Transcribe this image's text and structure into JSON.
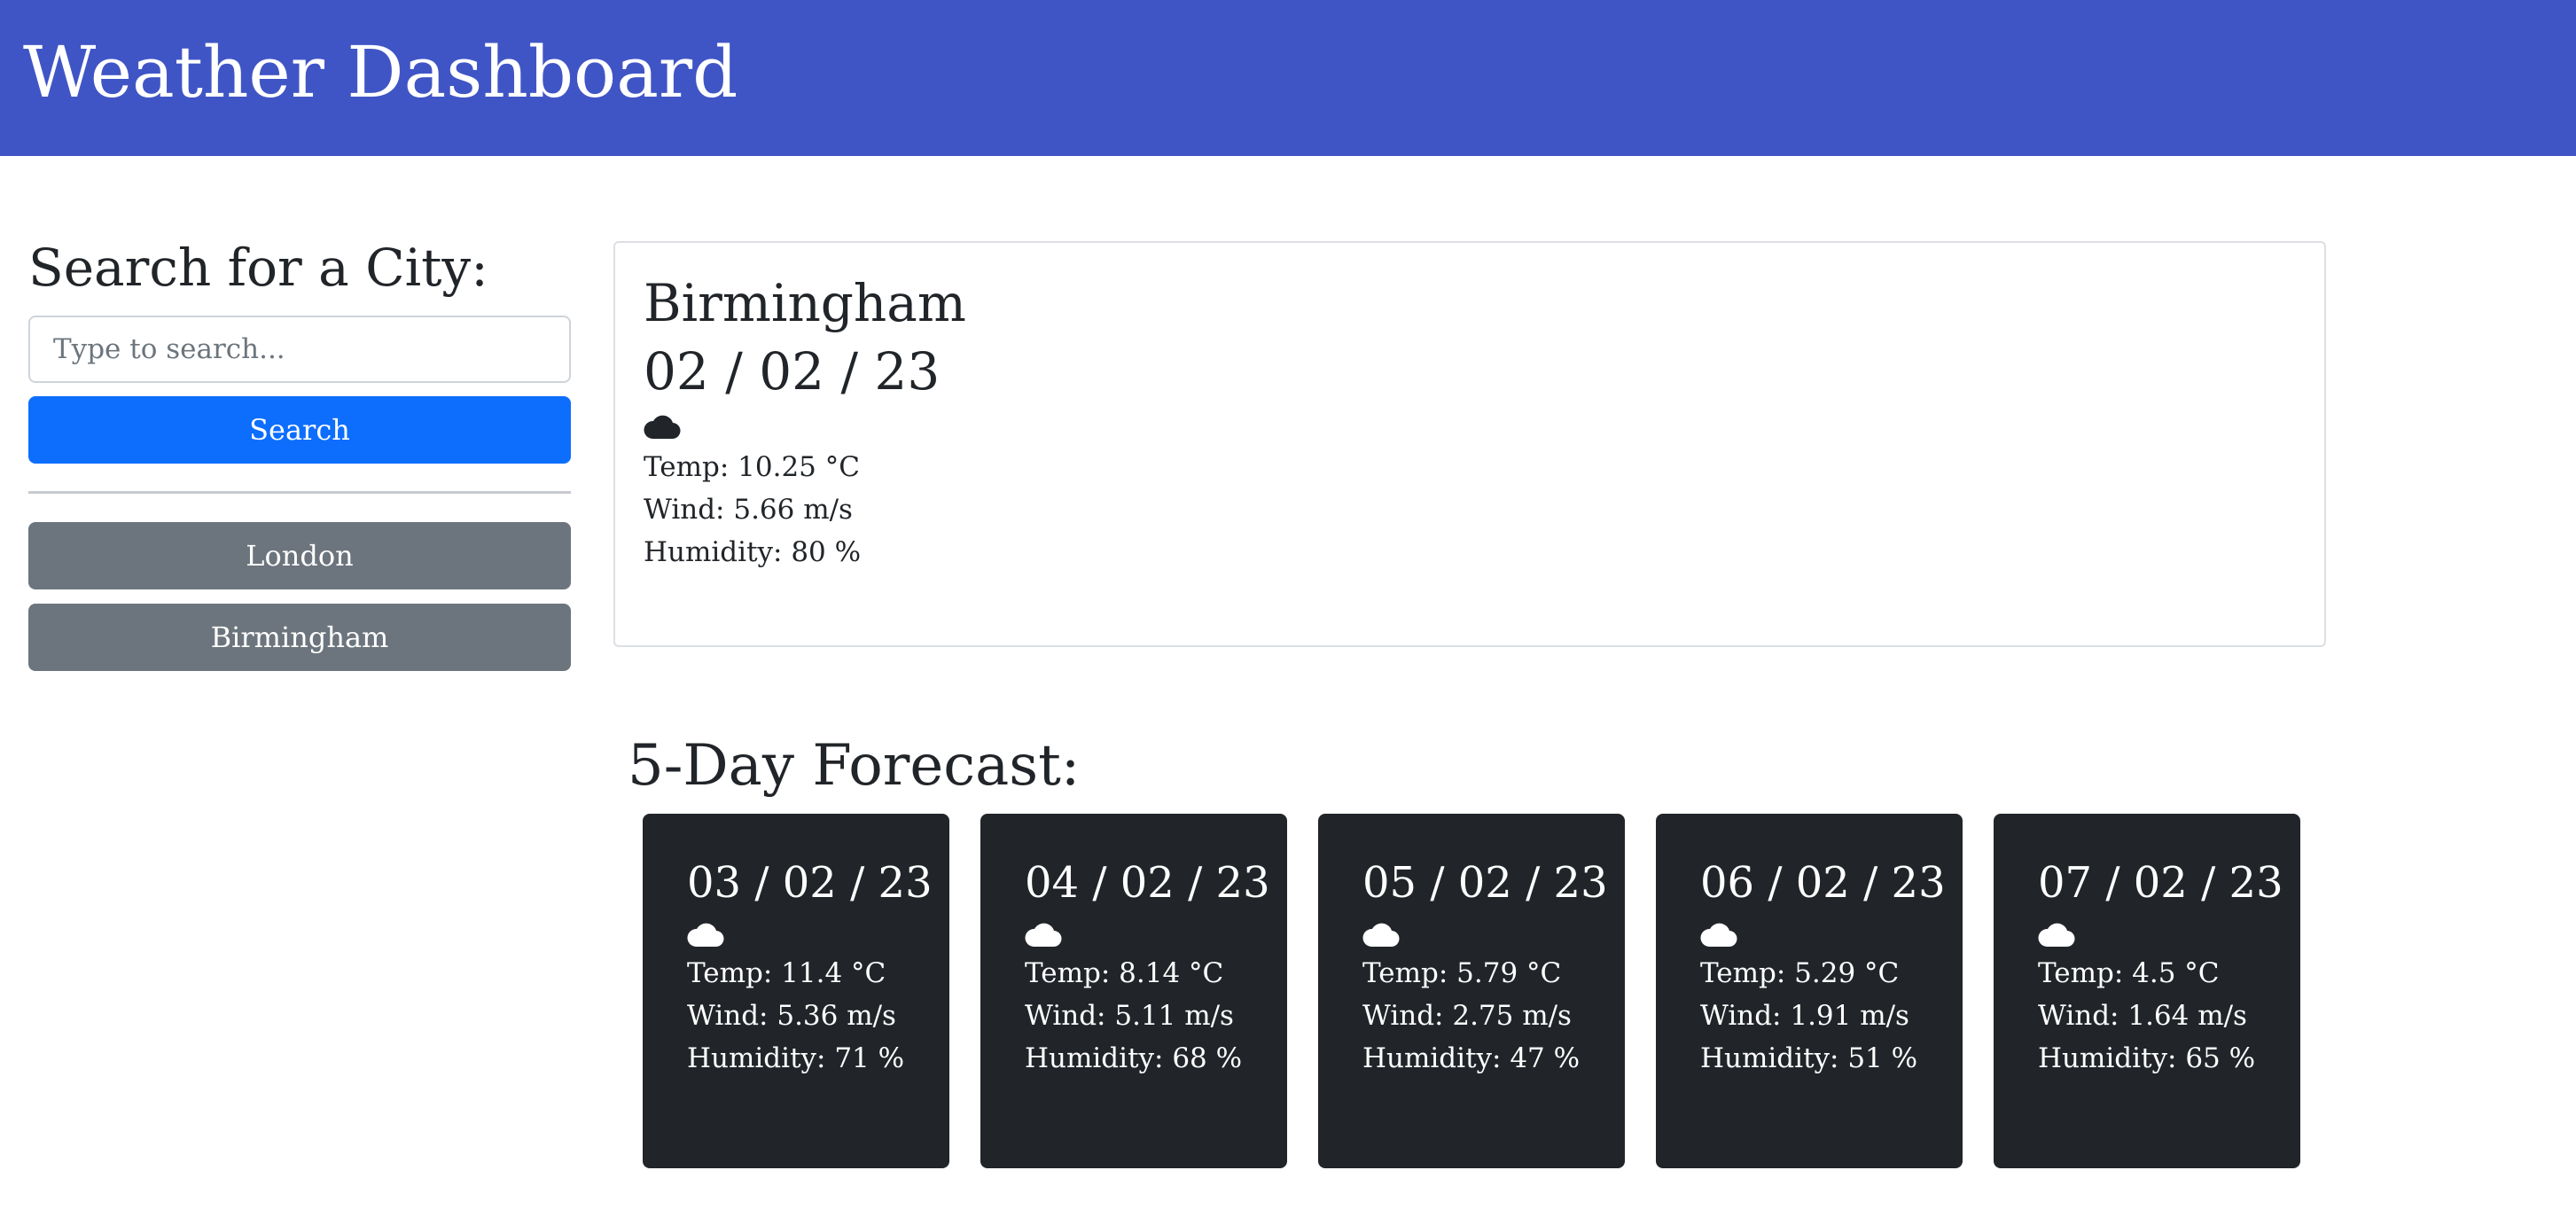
{
  "header": {
    "title": "Weather Dashboard"
  },
  "search": {
    "heading": "Search for a City:",
    "placeholder": "Type to search...",
    "button_label": "Search"
  },
  "history": [
    {
      "label": "London"
    },
    {
      "label": "Birmingham"
    }
  ],
  "current": {
    "city": "Birmingham",
    "date": "02 / 02 / 23",
    "icon": "cloud-icon",
    "icon_color": "#212529",
    "temp": "Temp: 10.25 °C",
    "wind": "Wind: 5.66 m/s",
    "humidity": "Humidity: 80 %"
  },
  "forecast": {
    "heading": "5-Day Forecast:",
    "days": [
      {
        "date": "03 / 02 / 23",
        "icon": "cloud-icon",
        "temp": "Temp: 11.4 °C",
        "wind": "Wind: 5.36 m/s",
        "humidity": "Humidity: 71 %"
      },
      {
        "date": "04 / 02 / 23",
        "icon": "cloud-icon",
        "temp": "Temp: 8.14 °C",
        "wind": "Wind: 5.11 m/s",
        "humidity": "Humidity: 68 %"
      },
      {
        "date": "05 / 02 / 23",
        "icon": "cloud-icon",
        "temp": "Temp: 5.79 °C",
        "wind": "Wind: 2.75 m/s",
        "humidity": "Humidity: 47 %"
      },
      {
        "date": "06 / 02 / 23",
        "icon": "cloud-icon",
        "temp": "Temp: 5.29 °C",
        "wind": "Wind: 1.91 m/s",
        "humidity": "Humidity: 51 %"
      },
      {
        "date": "07 / 02 / 23",
        "icon": "cloud-icon",
        "temp": "Temp: 4.5 °C",
        "wind": "Wind: 1.64 m/s",
        "humidity": "Humidity: 65 %"
      }
    ]
  },
  "colors": {
    "header_bg": "#4055c5",
    "primary": "#0d6efd",
    "secondary": "#6c757d",
    "card_dark": "#212529"
  }
}
